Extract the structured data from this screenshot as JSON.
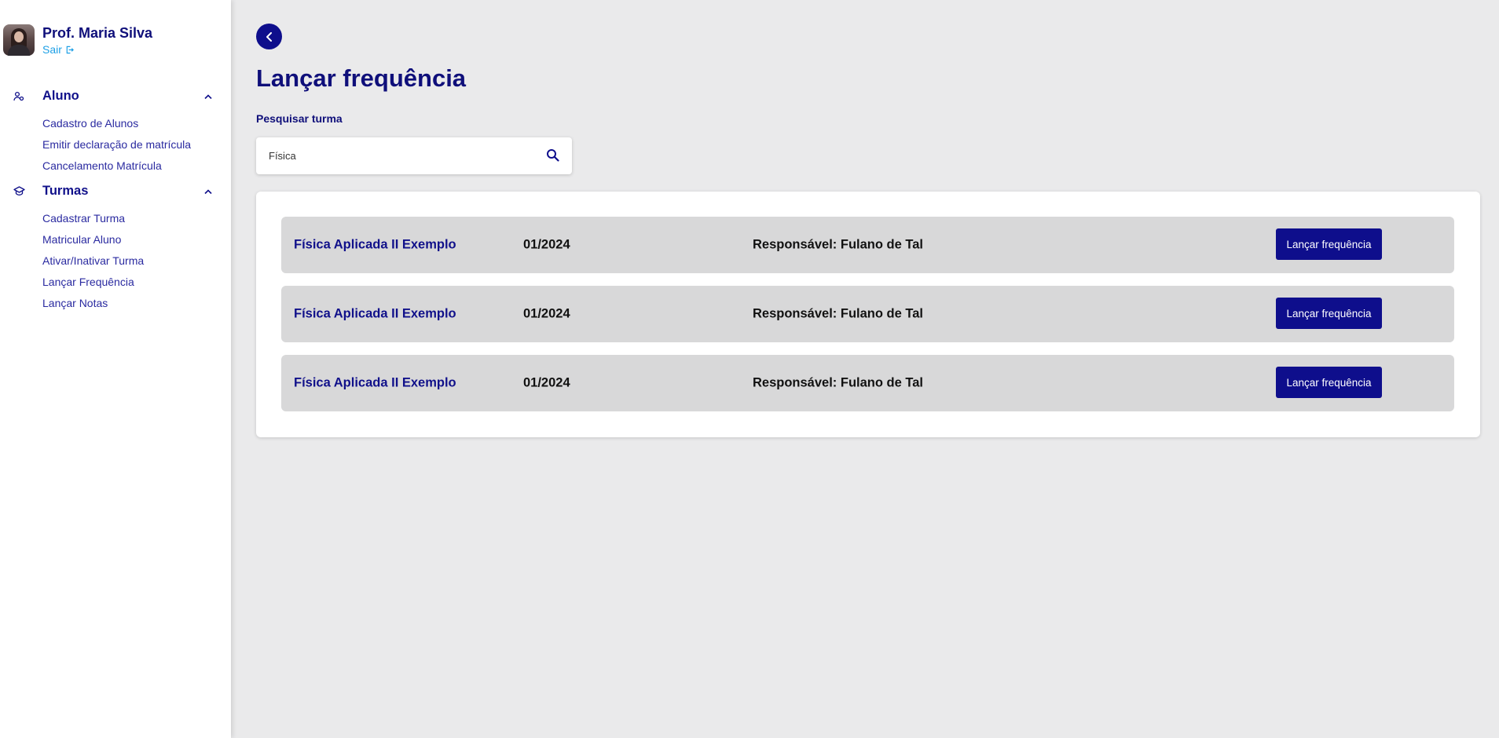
{
  "user": {
    "name": "Prof. Maria Silva",
    "logout_label": "Sair"
  },
  "sidebar": {
    "sections": [
      {
        "label": "Aluno",
        "items": [
          "Cadastro de Alunos",
          "Emitir declaração de matrícula",
          "Cancelamento Matrícula"
        ]
      },
      {
        "label": "Turmas",
        "items": [
          "Cadastrar Turma",
          "Matricular Aluno",
          "Ativar/Inativar Turma",
          "Lançar Frequência",
          "Lançar Notas"
        ]
      }
    ]
  },
  "main": {
    "title": "Lançar frequência",
    "search": {
      "label": "Pesquisar turma",
      "value": "Física"
    },
    "rows": [
      {
        "course": "Física Aplicada II Exemplo",
        "period": "01/2024",
        "responsible": "Responsável: Fulano de Tal",
        "button": "Lançar frequência"
      },
      {
        "course": "Física Aplicada II Exemplo",
        "period": "01/2024",
        "responsible": "Responsável: Fulano de Tal",
        "button": "Lançar frequência"
      },
      {
        "course": "Física Aplicada II Exemplo",
        "period": "01/2024",
        "responsible": "Responsável: Fulano de Tal",
        "button": "Lançar frequência"
      }
    ]
  },
  "colors": {
    "primary": "#0e0e8c",
    "title": "#0f0f7a",
    "link": "#1ea0e6",
    "background": "#eaeaeb",
    "row": "#d8d8d9"
  },
  "icons": {
    "back": "chevron-left-icon",
    "search": "search-icon",
    "logout": "logout-icon",
    "aluno": "users-icon",
    "turmas": "graduation-cap-icon",
    "expand": "chevron-up-icon"
  }
}
